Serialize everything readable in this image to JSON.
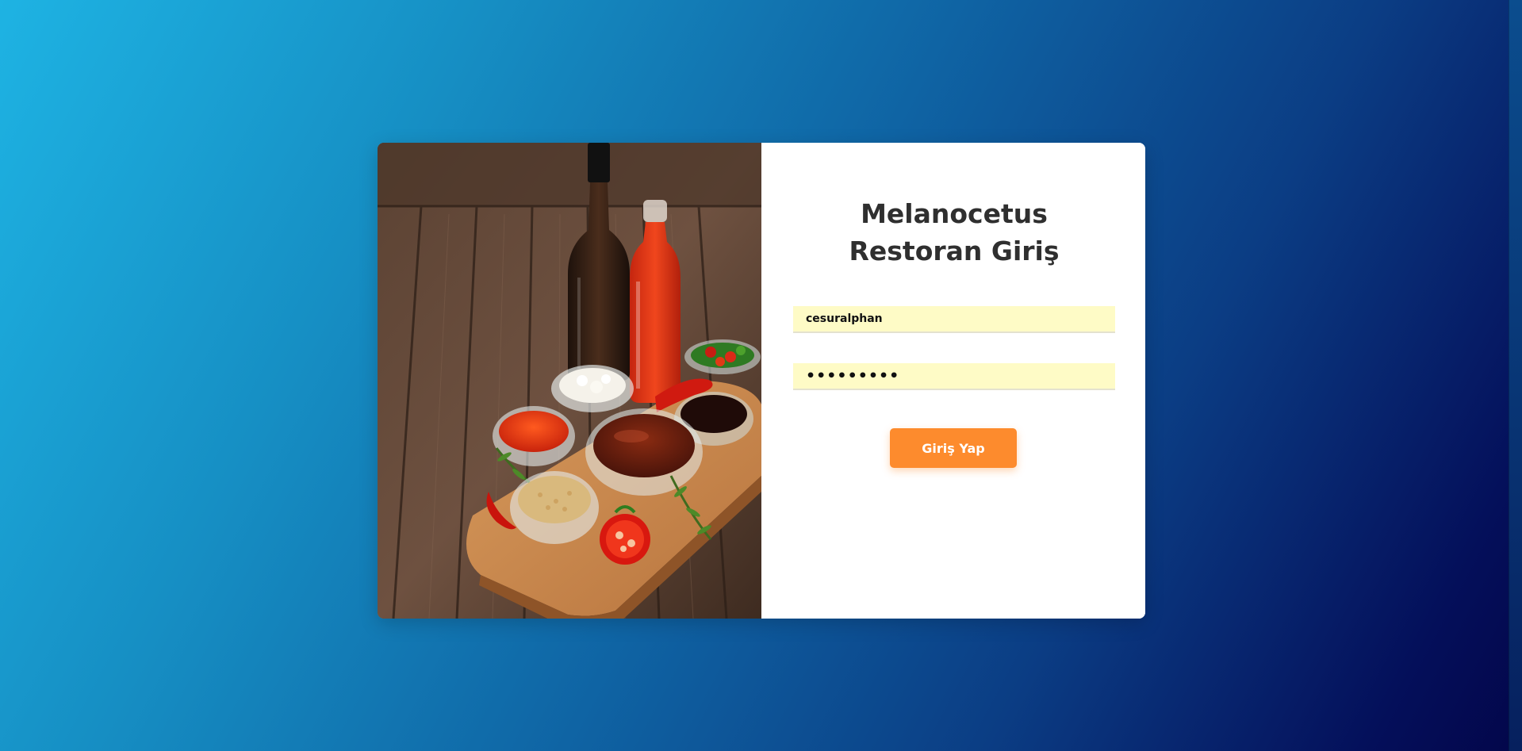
{
  "login": {
    "title": "Melanocetus Restoran Giriş",
    "username_value": "cesuralphan",
    "password_mask": "•••••••••",
    "submit_label": "Giriş Yap"
  },
  "colors": {
    "button": "#fd8b2d",
    "input_bg": "#fefbc6",
    "title": "#2f2f2f",
    "background_start": "#1eb3e3",
    "background_end": "#03064a"
  },
  "image": {
    "subject": "sauces-on-wooden-board"
  }
}
